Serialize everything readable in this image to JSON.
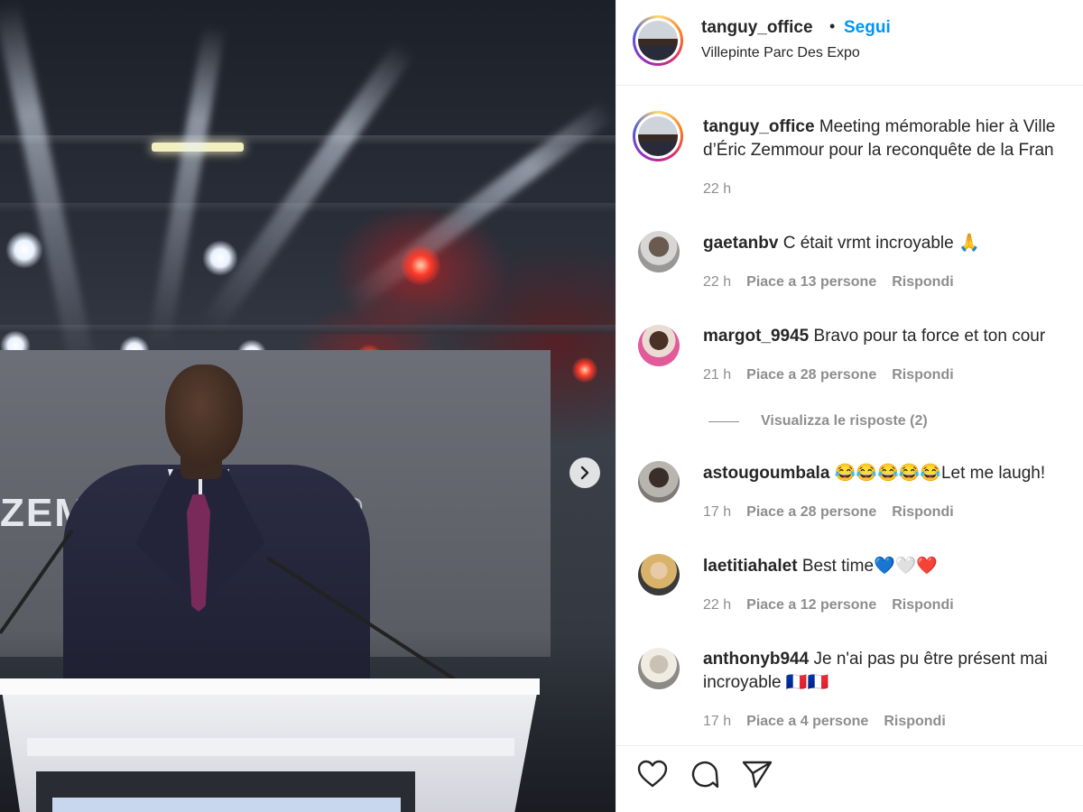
{
  "post": {
    "author": "tanguy_office",
    "follow_label": "Segui",
    "separator": "•",
    "location": "Villepinte Parc Des Expo",
    "caption_line1": "Meeting mémorable hier à Ville",
    "caption_line2": "d’Éric Zemmour pour la reconquête de la Fran",
    "caption_time": "22 h",
    "photo_text_left": "ZEM",
    "photo_text_right": "022"
  },
  "comments": [
    {
      "user": "gaetanbv",
      "text": "C était vrmt incroyable 🙏",
      "time": "22 h",
      "likes": "Piace a 13 persone",
      "reply": "Rispondi"
    },
    {
      "user": "margot_9945",
      "text": "Bravo pour ta force et ton cour",
      "time": "21 h",
      "likes": "Piace a 28 persone",
      "reply": "Rispondi"
    },
    {
      "user": "astougoumbala",
      "text": "😂😂😂😂😂Let me laugh!",
      "time": "17 h",
      "likes": "Piace a 28 persone",
      "reply": "Rispondi"
    },
    {
      "user": "laetitiahalet",
      "text": "Best time💙🤍❤️",
      "time": "22 h",
      "likes": "Piace a 12 persone",
      "reply": "Rispondi"
    },
    {
      "user": "anthonyb944",
      "text": "Je n'ai pas pu être présent mai",
      "text2": "incroyable 🇫🇷🇫🇷",
      "time": "17 h",
      "likes": "Piace a 4 persone",
      "reply": "Rispondi"
    }
  ],
  "view_replies": "Visualizza le risposte (2)",
  "icons": {
    "next": "chevron-right-icon",
    "like": "heart-icon",
    "comment": "comment-bubble-icon",
    "share": "paper-plane-icon"
  },
  "colors": {
    "follow": "#0095f6",
    "muted": "#8e8e8e",
    "text": "#262626"
  }
}
